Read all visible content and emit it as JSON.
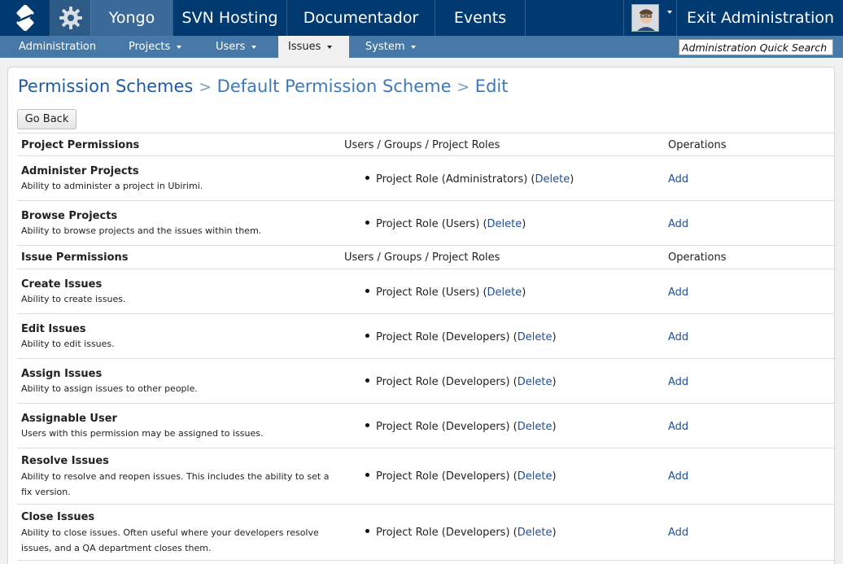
{
  "topnav": {
    "items": [
      {
        "label": "Yongo",
        "active": true
      },
      {
        "label": "SVN Hosting",
        "active": false
      },
      {
        "label": "Documentador",
        "active": false
      },
      {
        "label": "Events",
        "active": false
      }
    ],
    "exit_label": "Exit Administration"
  },
  "subnav": {
    "items": [
      {
        "label": "Administration"
      },
      {
        "label": "Projects"
      },
      {
        "label": "Users"
      },
      {
        "label": "Issues"
      },
      {
        "label": "System"
      }
    ],
    "search_value": "Administration Quick Search"
  },
  "breadcrumb": {
    "root": "Permission Schemes",
    "separator": ">",
    "scheme": "Default Permission Scheme",
    "action": "Edit"
  },
  "go_back_label": "Go Back",
  "sections": [
    {
      "header": {
        "title": "Project Permissions",
        "col2": "Users / Groups / Project Roles",
        "col3": "Operations"
      },
      "rows": [
        {
          "name": "Administer Projects",
          "desc": "Ability to administer a project in Ubirimi.",
          "role": "Project Role (Administrators)",
          "delete": "Delete",
          "add": "Add"
        },
        {
          "name": "Browse Projects",
          "desc": "Ability to browse projects and the issues within them.",
          "role": "Project Role (Users)",
          "delete": "Delete",
          "add": "Add"
        }
      ]
    },
    {
      "header": {
        "title": "Issue Permissions",
        "col2": "Users / Groups / Project Roles",
        "col3": "Operations"
      },
      "rows": [
        {
          "name": "Create Issues",
          "desc": "Ability to create issues.",
          "role": "Project Role (Users)",
          "delete": "Delete",
          "add": "Add"
        },
        {
          "name": "Edit Issues",
          "desc": "Ability to edit issues.",
          "role": "Project Role (Developers)",
          "delete": "Delete",
          "add": "Add"
        },
        {
          "name": "Assign Issues",
          "desc": "Ability to assign issues to other people.",
          "role": "Project Role (Developers)",
          "delete": "Delete",
          "add": "Add"
        },
        {
          "name": "Assignable User",
          "desc": "Users with this permission may be assigned to issues.",
          "role": "Project Role (Developers)",
          "delete": "Delete",
          "add": "Add"
        },
        {
          "name": "Resolve Issues",
          "desc": "Ability to resolve and reopen issues. This includes the ability to set a fix version.",
          "role": "Project Role (Developers)",
          "delete": "Delete",
          "add": "Add"
        },
        {
          "name": "Close Issues",
          "desc": "Ability to close issues. Often useful where your developers resolve issues, and a QA department closes them.",
          "role": "Project Role (Developers)",
          "delete": "Delete",
          "add": "Add"
        }
      ]
    }
  ]
}
